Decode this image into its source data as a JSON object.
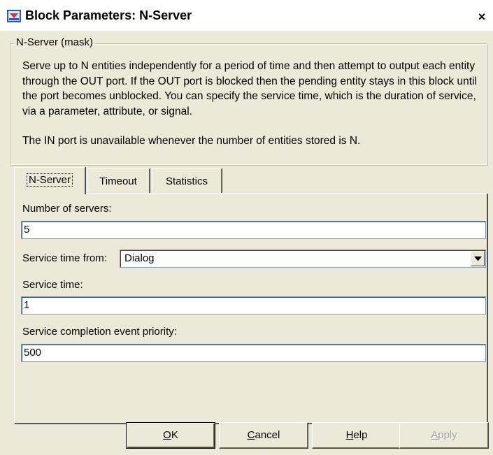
{
  "window": {
    "title": "Block Parameters: N-Server",
    "close_glyph": "×"
  },
  "group": {
    "legend": "N-Server (mask)",
    "description": "Serve up to N entities independently for a period of time and then attempt to output each entity through the OUT port. If the OUT port is blocked then the pending entity stays in this block until the port becomes unblocked. You can specify the service time, which is the duration of service, via a parameter, attribute, or signal.",
    "note": "The IN port is unavailable whenever the number of entities stored is N."
  },
  "tabs": [
    {
      "label": "N-Server",
      "active": true
    },
    {
      "label": "Timeout",
      "active": false
    },
    {
      "label": "Statistics",
      "active": false
    }
  ],
  "form": {
    "num_servers": {
      "label": "Number of servers:",
      "value": "5"
    },
    "service_time_from": {
      "label": "Service time from:",
      "value": "Dialog"
    },
    "service_time": {
      "label": "Service time:",
      "value": "1"
    },
    "priority": {
      "label": "Service completion event priority:",
      "value": "500"
    }
  },
  "buttons": {
    "ok": {
      "mnemonic": "O",
      "rest": "K"
    },
    "cancel": {
      "mnemonic": "C",
      "rest": "ancel"
    },
    "help": {
      "mnemonic": "H",
      "rest": "elp"
    },
    "apply": {
      "mnemonic": "A",
      "rest": "pply"
    }
  },
  "icons": {
    "app": "simulink-block-icon",
    "close": "close-icon",
    "dropdown": "chevron-down-icon"
  },
  "colors": {
    "face": "#ece9d8",
    "field_border": "#7f9db9",
    "disabled_text": "#a0a0a0"
  }
}
